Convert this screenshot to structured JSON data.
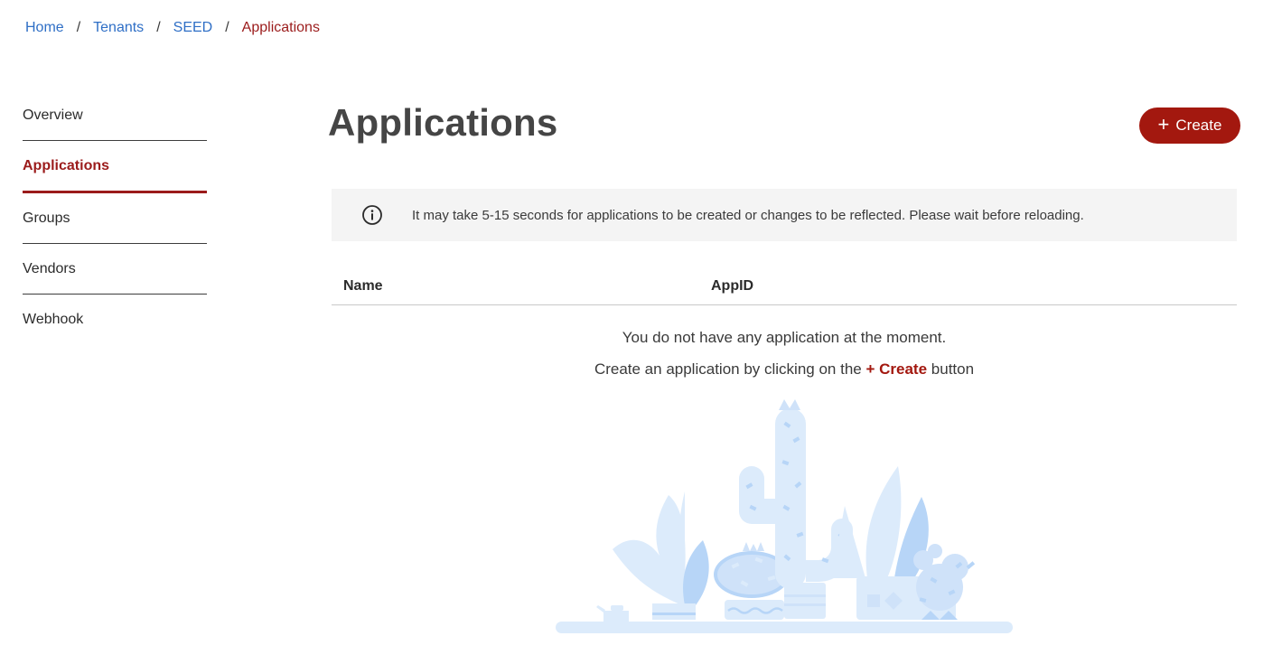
{
  "breadcrumb": {
    "items": [
      "Home",
      "Tenants",
      "SEED"
    ],
    "current": "Applications",
    "separator": "/"
  },
  "sidebar": {
    "items": [
      {
        "label": "Overview",
        "active": false
      },
      {
        "label": "Applications",
        "active": true
      },
      {
        "label": "Groups",
        "active": false
      },
      {
        "label": "Vendors",
        "active": false
      },
      {
        "label": "Webhook",
        "active": false
      }
    ]
  },
  "main": {
    "title": "Applications",
    "create_button": {
      "icon": "+",
      "label": "Create"
    },
    "info_banner": {
      "icon": "info-icon",
      "text": "It may take 5-15 seconds for applications to be created or changes to be reflected. Please wait before reloading."
    },
    "table": {
      "columns": [
        "Name",
        "AppID"
      ],
      "rows": []
    },
    "empty_state": {
      "line1": "You do not have any application at the moment.",
      "line2_prefix": "Create an application by clicking on the",
      "line2_link": "+ Create",
      "line2_suffix": "button",
      "illustration": "cactus-plants-illustration"
    }
  },
  "colors": {
    "accent": "#a3180f",
    "link": "#2f6fc6",
    "banner_bg": "#f4f4f4",
    "illustration_light": "#dcebfb",
    "illustration_mid": "#b7d5f7"
  }
}
